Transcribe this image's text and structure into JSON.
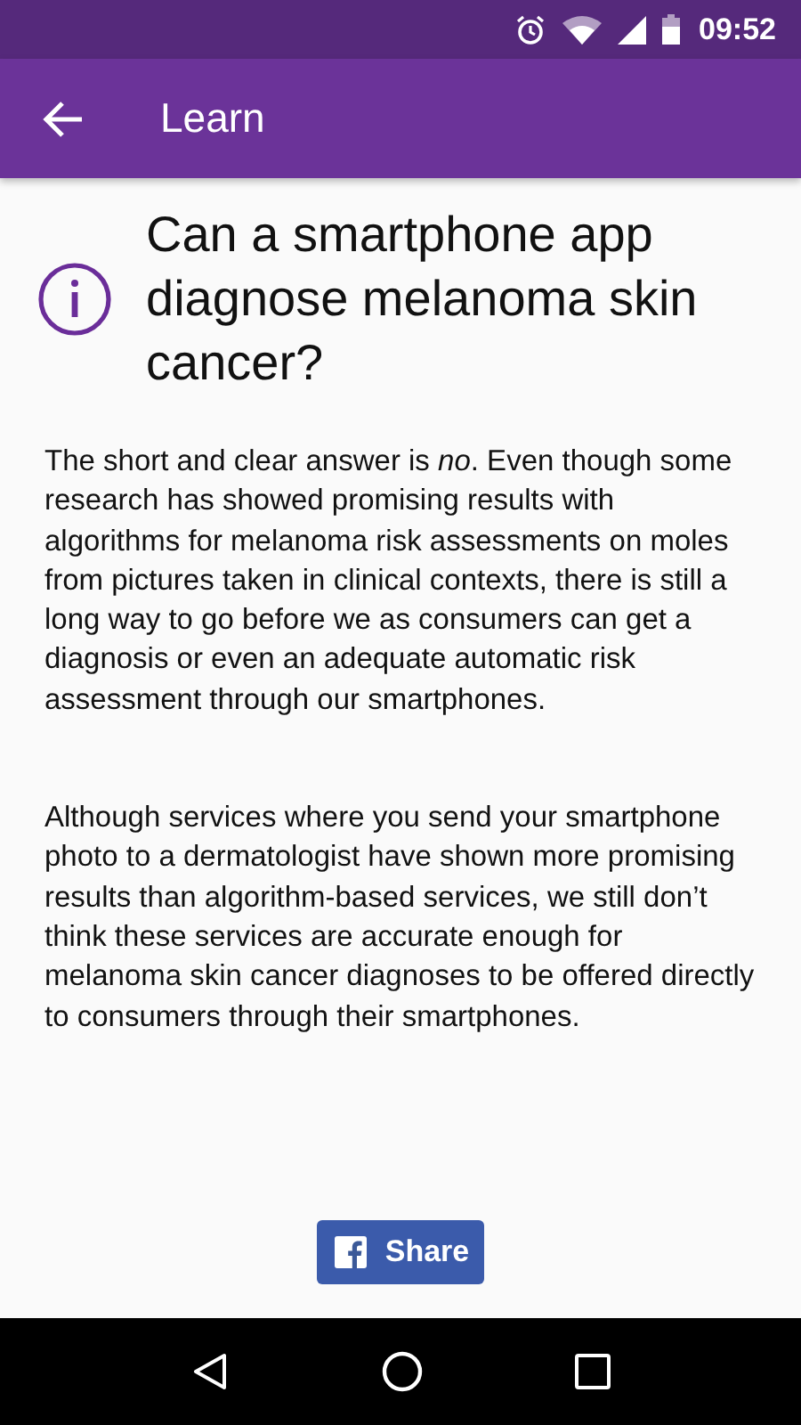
{
  "status_bar": {
    "time": "09:52"
  },
  "app_bar": {
    "title": "Learn"
  },
  "article": {
    "title": "Can a smartphone app diagnose melanoma skin cancer?",
    "paragraphs": [
      "The short and clear answer is *no*. Even though some research has showed promising results with algorithms for melanoma risk assessments on moles from pictures taken in clinical contexts, there is still a long way to go before we as consumers can get a diagnosis or even an adequate automatic risk assessment through our smartphones.",
      "Although services where you send your smartphone photo to a dermatologist have shown more promising results than algorithm-based services, we still don’t think these services are accurate enough for melanoma skin cancer diagnoses to be offered directly to consumers through their smartphones."
    ]
  },
  "share_button": {
    "label": "Share"
  }
}
